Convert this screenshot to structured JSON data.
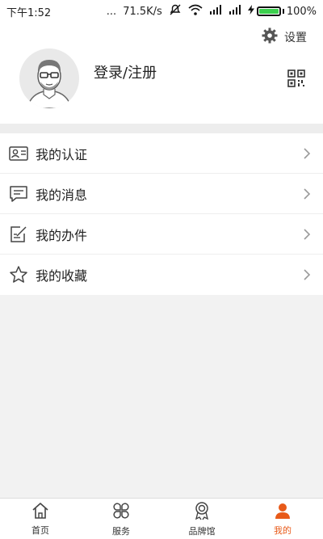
{
  "status": {
    "time": "下午1:52",
    "dots": "...",
    "network": "71.5K/s",
    "battery": "100%"
  },
  "header": {
    "settings_label": "设置",
    "login_label": "登录/注册"
  },
  "menu": [
    {
      "label": "我的认证",
      "icon": "id-card-icon"
    },
    {
      "label": "我的消息",
      "icon": "message-icon"
    },
    {
      "label": "我的办件",
      "icon": "document-edit-icon"
    },
    {
      "label": "我的收藏",
      "icon": "star-icon"
    }
  ],
  "tabs": [
    {
      "label": "首页",
      "icon": "home-icon"
    },
    {
      "label": "服务",
      "icon": "clover-icon"
    },
    {
      "label": "品牌馆",
      "icon": "medal-icon"
    },
    {
      "label": "我的",
      "icon": "user-icon"
    }
  ],
  "colors": {
    "accent": "#e85a19",
    "battery": "#3ccf4e"
  }
}
